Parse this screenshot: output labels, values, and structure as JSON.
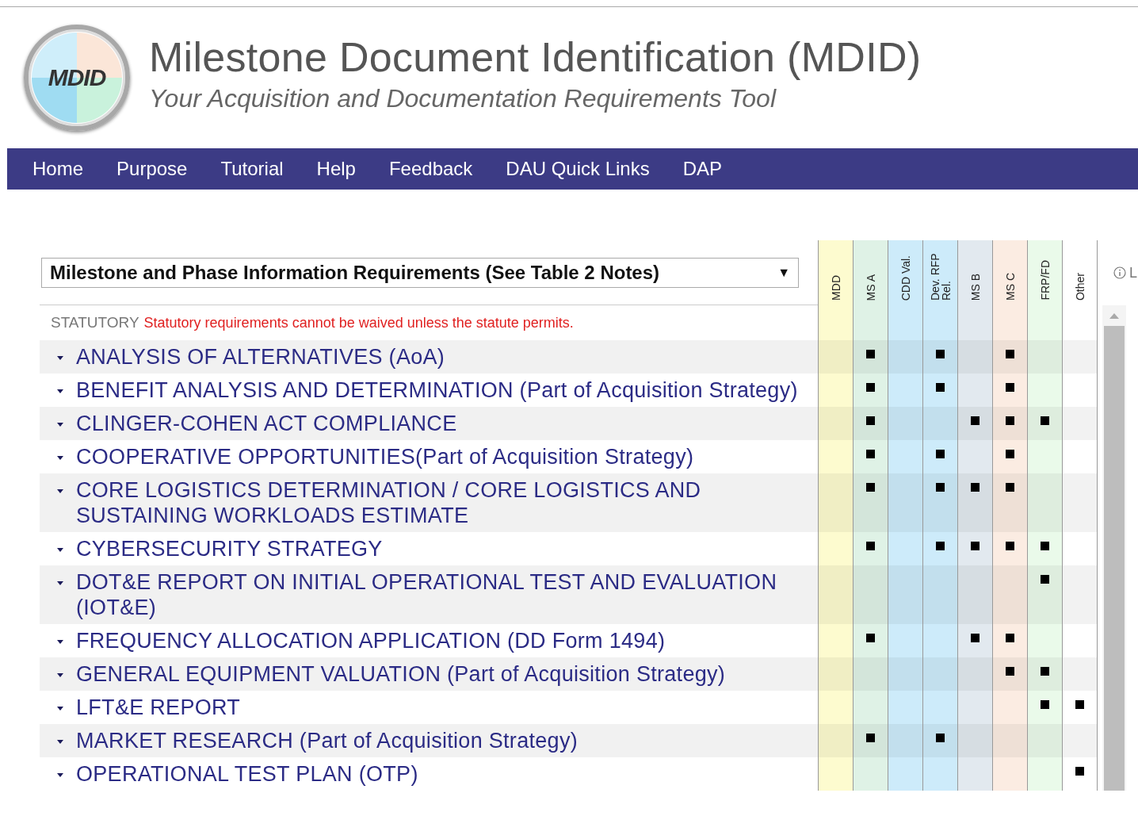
{
  "header": {
    "logo_text": "MDID",
    "title": "Milestone Document Identification (MDID)",
    "subtitle": "Your Acquisition and Documentation Requirements Tool"
  },
  "nav": [
    "Home",
    "Purpose",
    "Tutorial",
    "Help",
    "Feedback",
    "DAU Quick Links",
    "DAP"
  ],
  "table": {
    "select": {
      "value": "Milestone and Phase Information Requirements (See Table 2 Notes)",
      "arrow": "▼"
    },
    "info_label": "L",
    "columns": [
      {
        "label": "MDD",
        "color": "#fdfbcf"
      },
      {
        "label": "MS A",
        "color": "#dff2e6"
      },
      {
        "label": "CDD Val.",
        "color": "#cdebfa"
      },
      {
        "label": "Dev. RFP Rel.",
        "color": "#cdebfa"
      },
      {
        "label": "MS B",
        "color": "#e2e9ef"
      },
      {
        "label": "MS C",
        "color": "#fbece2"
      },
      {
        "label": "FRP/FD",
        "color": "#eafaea"
      },
      {
        "label": "Other",
        "color": "#ffffff"
      }
    ],
    "category": {
      "label": "STATUTORY",
      "note": "Statutory requirements cannot be waived unless the statute permits."
    },
    "rows": [
      {
        "title": "ANALYSIS OF ALTERNATIVES (AoA)",
        "expanded": false,
        "marks": [
          false,
          true,
          false,
          true,
          false,
          true,
          false,
          false
        ]
      },
      {
        "title": "BENEFIT ANALYSIS AND DETERMINATION (Part of Acquisition Strategy)",
        "expanded": false,
        "marks": [
          false,
          true,
          false,
          true,
          false,
          true,
          false,
          false
        ]
      },
      {
        "title": "CLINGER-COHEN ACT COMPLIANCE",
        "expanded": false,
        "marks": [
          false,
          true,
          false,
          false,
          true,
          true,
          true,
          false
        ]
      },
      {
        "title": "COOPERATIVE OPPORTUNITIES(Part of Acquisition Strategy)",
        "expanded": false,
        "marks": [
          false,
          true,
          false,
          true,
          false,
          true,
          false,
          false
        ]
      },
      {
        "title": "CORE LOGISTICS DETERMINATION / CORE LOGISTICS AND SUSTAINING WORKLOADS ESTIMATE",
        "expanded": false,
        "marks": [
          false,
          true,
          false,
          true,
          true,
          true,
          false,
          false
        ]
      },
      {
        "title": "CYBERSECURITY STRATEGY",
        "expanded": false,
        "marks": [
          false,
          true,
          false,
          true,
          true,
          true,
          true,
          false
        ]
      },
      {
        "title": "DOT&E REPORT ON INITIAL OPERATIONAL TEST AND EVALUATION (IOT&E)",
        "expanded": false,
        "marks": [
          false,
          false,
          false,
          false,
          false,
          false,
          true,
          false
        ]
      },
      {
        "title": "FREQUENCY ALLOCATION APPLICATION (DD Form 1494)",
        "expanded": false,
        "marks": [
          false,
          true,
          false,
          false,
          true,
          true,
          false,
          false
        ]
      },
      {
        "title": "GENERAL EQUIPMENT VALUATION (Part of Acquisition Strategy)",
        "expanded": false,
        "marks": [
          false,
          false,
          false,
          false,
          false,
          true,
          true,
          false
        ]
      },
      {
        "title": "LFT&E REPORT",
        "expanded": false,
        "marks": [
          false,
          false,
          false,
          false,
          false,
          false,
          true,
          true
        ]
      },
      {
        "title": "MARKET RESEARCH (Part of Acquisition Strategy)",
        "expanded": false,
        "marks": [
          false,
          true,
          false,
          true,
          false,
          false,
          false,
          false
        ]
      },
      {
        "title": "OPERATIONAL TEST PLAN (OTP)",
        "expanded": false,
        "marks": [
          false,
          false,
          false,
          false,
          false,
          false,
          false,
          true
        ]
      }
    ]
  }
}
